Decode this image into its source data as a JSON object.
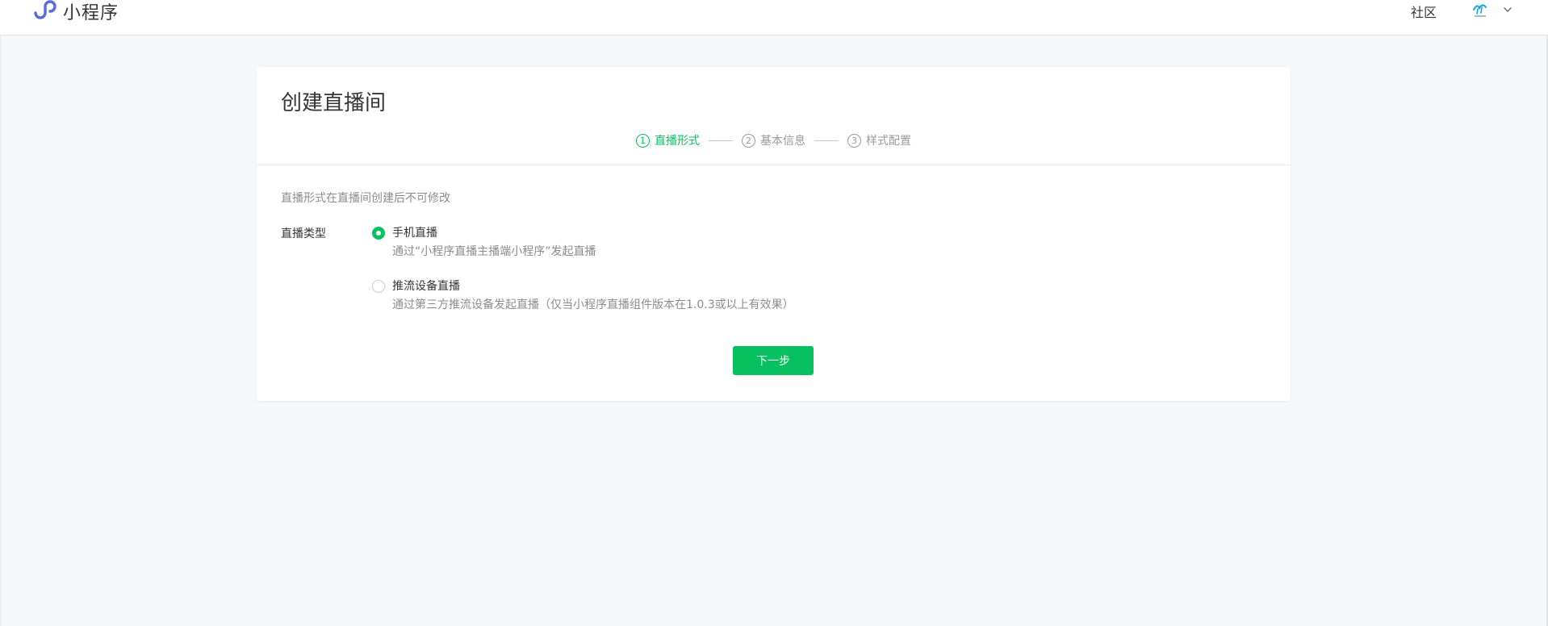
{
  "header": {
    "brand": "小程序",
    "community_link": "社区",
    "avatar_icon": "brand-avatar-icon",
    "chevron_icon": "chevron-down-icon"
  },
  "page": {
    "title": "创建直播间",
    "steps": [
      {
        "num": "1",
        "label": "直播形式",
        "active": true
      },
      {
        "num": "2",
        "label": "基本信息",
        "active": false
      },
      {
        "num": "3",
        "label": "样式配置",
        "active": false
      }
    ],
    "notice": "直播形式在直播间创建后不可修改",
    "field_label": "直播类型",
    "options": [
      {
        "title": "手机直播",
        "desc": "通过“小程序直播主播端小程序”发起直播",
        "selected": true
      },
      {
        "title": "推流设备直播",
        "desc": "通过第三方推流设备发起直播（仅当小程序直播组件版本在1.0.3或以上有效果）",
        "selected": false
      }
    ],
    "next_button": "下一步"
  },
  "colors": {
    "accent": "#07c160",
    "brand_logo": "#5a6bdc",
    "text": "#353535",
    "muted": "#8c8c8c",
    "background": "#f6f7f9"
  }
}
